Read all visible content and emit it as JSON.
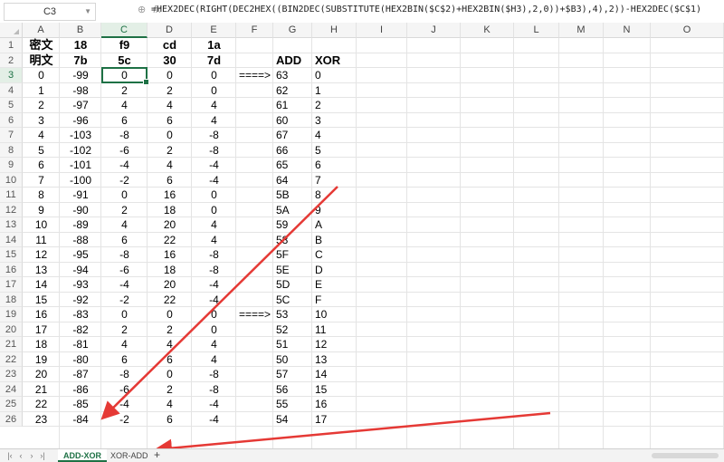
{
  "formula_bar": {
    "cell_ref": "C3",
    "fx": "fx",
    "formula": "=HEX2DEC(RIGHT(DEC2HEX((BIN2DEC(SUBSTITUTE(HEX2BIN($C$2)+HEX2BIN($H3),2,0))+$B3),4),2))-HEX2DEC($C$1)"
  },
  "columns": [
    "A",
    "B",
    "C",
    "D",
    "E",
    "F",
    "G",
    "H",
    "I",
    "J",
    "K",
    "L",
    "M",
    "N",
    "O"
  ],
  "rows": [
    {
      "n": "1",
      "A": "密文",
      "B": "18",
      "C": "f9",
      "D": "cd",
      "E": "1a",
      "F": "",
      "G": "",
      "H": ""
    },
    {
      "n": "2",
      "A": "明文",
      "B": "7b",
      "C": "5c",
      "D": "30",
      "E": "7d",
      "F": "",
      "G": "ADD",
      "H": "XOR"
    },
    {
      "n": "3",
      "A": "0",
      "B": "-99",
      "C": "0",
      "D": "0",
      "E": "0",
      "F": "====>",
      "G": "63",
      "H": "0"
    },
    {
      "n": "4",
      "A": "1",
      "B": "-98",
      "C": "2",
      "D": "2",
      "E": "0",
      "F": "",
      "G": "62",
      "H": "1"
    },
    {
      "n": "5",
      "A": "2",
      "B": "-97",
      "C": "4",
      "D": "4",
      "E": "4",
      "F": "",
      "G": "61",
      "H": "2"
    },
    {
      "n": "6",
      "A": "3",
      "B": "-96",
      "C": "6",
      "D": "6",
      "E": "4",
      "F": "",
      "G": "60",
      "H": "3"
    },
    {
      "n": "7",
      "A": "4",
      "B": "-103",
      "C": "-8",
      "D": "0",
      "E": "-8",
      "F": "",
      "G": "67",
      "H": "4"
    },
    {
      "n": "8",
      "A": "5",
      "B": "-102",
      "C": "-6",
      "D": "2",
      "E": "-8",
      "F": "",
      "G": "66",
      "H": "5"
    },
    {
      "n": "9",
      "A": "6",
      "B": "-101",
      "C": "-4",
      "D": "4",
      "E": "-4",
      "F": "",
      "G": "65",
      "H": "6"
    },
    {
      "n": "10",
      "A": "7",
      "B": "-100",
      "C": "-2",
      "D": "6",
      "E": "-4",
      "F": "",
      "G": "64",
      "H": "7"
    },
    {
      "n": "11",
      "A": "8",
      "B": "-91",
      "C": "0",
      "D": "16",
      "E": "0",
      "F": "",
      "G": "5B",
      "H": "8"
    },
    {
      "n": "12",
      "A": "9",
      "B": "-90",
      "C": "2",
      "D": "18",
      "E": "0",
      "F": "",
      "G": "5A",
      "H": "9"
    },
    {
      "n": "13",
      "A": "10",
      "B": "-89",
      "C": "4",
      "D": "20",
      "E": "4",
      "F": "",
      "G": "59",
      "H": "A"
    },
    {
      "n": "14",
      "A": "11",
      "B": "-88",
      "C": "6",
      "D": "22",
      "E": "4",
      "F": "",
      "G": "58",
      "H": "B"
    },
    {
      "n": "15",
      "A": "12",
      "B": "-95",
      "C": "-8",
      "D": "16",
      "E": "-8",
      "F": "",
      "G": "5F",
      "H": "C"
    },
    {
      "n": "16",
      "A": "13",
      "B": "-94",
      "C": "-6",
      "D": "18",
      "E": "-8",
      "F": "",
      "G": "5E",
      "H": "D"
    },
    {
      "n": "17",
      "A": "14",
      "B": "-93",
      "C": "-4",
      "D": "20",
      "E": "-4",
      "F": "",
      "G": "5D",
      "H": "E"
    },
    {
      "n": "18",
      "A": "15",
      "B": "-92",
      "C": "-2",
      "D": "22",
      "E": "-4",
      "F": "",
      "G": "5C",
      "H": "F"
    },
    {
      "n": "19",
      "A": "16",
      "B": "-83",
      "C": "0",
      "D": "0",
      "E": "0",
      "F": "====>",
      "G": "53",
      "H": "10"
    },
    {
      "n": "20",
      "A": "17",
      "B": "-82",
      "C": "2",
      "D": "2",
      "E": "0",
      "F": "",
      "G": "52",
      "H": "11"
    },
    {
      "n": "21",
      "A": "18",
      "B": "-81",
      "C": "4",
      "D": "4",
      "E": "4",
      "F": "",
      "G": "51",
      "H": "12"
    },
    {
      "n": "22",
      "A": "19",
      "B": "-80",
      "C": "6",
      "D": "6",
      "E": "4",
      "F": "",
      "G": "50",
      "H": "13"
    },
    {
      "n": "23",
      "A": "20",
      "B": "-87",
      "C": "-8",
      "D": "0",
      "E": "-8",
      "F": "",
      "G": "57",
      "H": "14"
    },
    {
      "n": "24",
      "A": "21",
      "B": "-86",
      "C": "-6",
      "D": "2",
      "E": "-8",
      "F": "",
      "G": "56",
      "H": "15"
    },
    {
      "n": "25",
      "A": "22",
      "B": "-85",
      "C": "-4",
      "D": "4",
      "E": "-4",
      "F": "",
      "G": "55",
      "H": "16"
    },
    {
      "n": "26",
      "A": "23",
      "B": "-84",
      "C": "-2",
      "D": "6",
      "E": "-4",
      "F": "",
      "G": "54",
      "H": "17"
    }
  ],
  "tabs": [
    {
      "label": "ADD-XOR",
      "active": true
    },
    {
      "label": "XOR-ADD",
      "active": false
    }
  ],
  "add_tab": "+",
  "accent_color": "#1e7145",
  "annotation_color": "#e53935"
}
